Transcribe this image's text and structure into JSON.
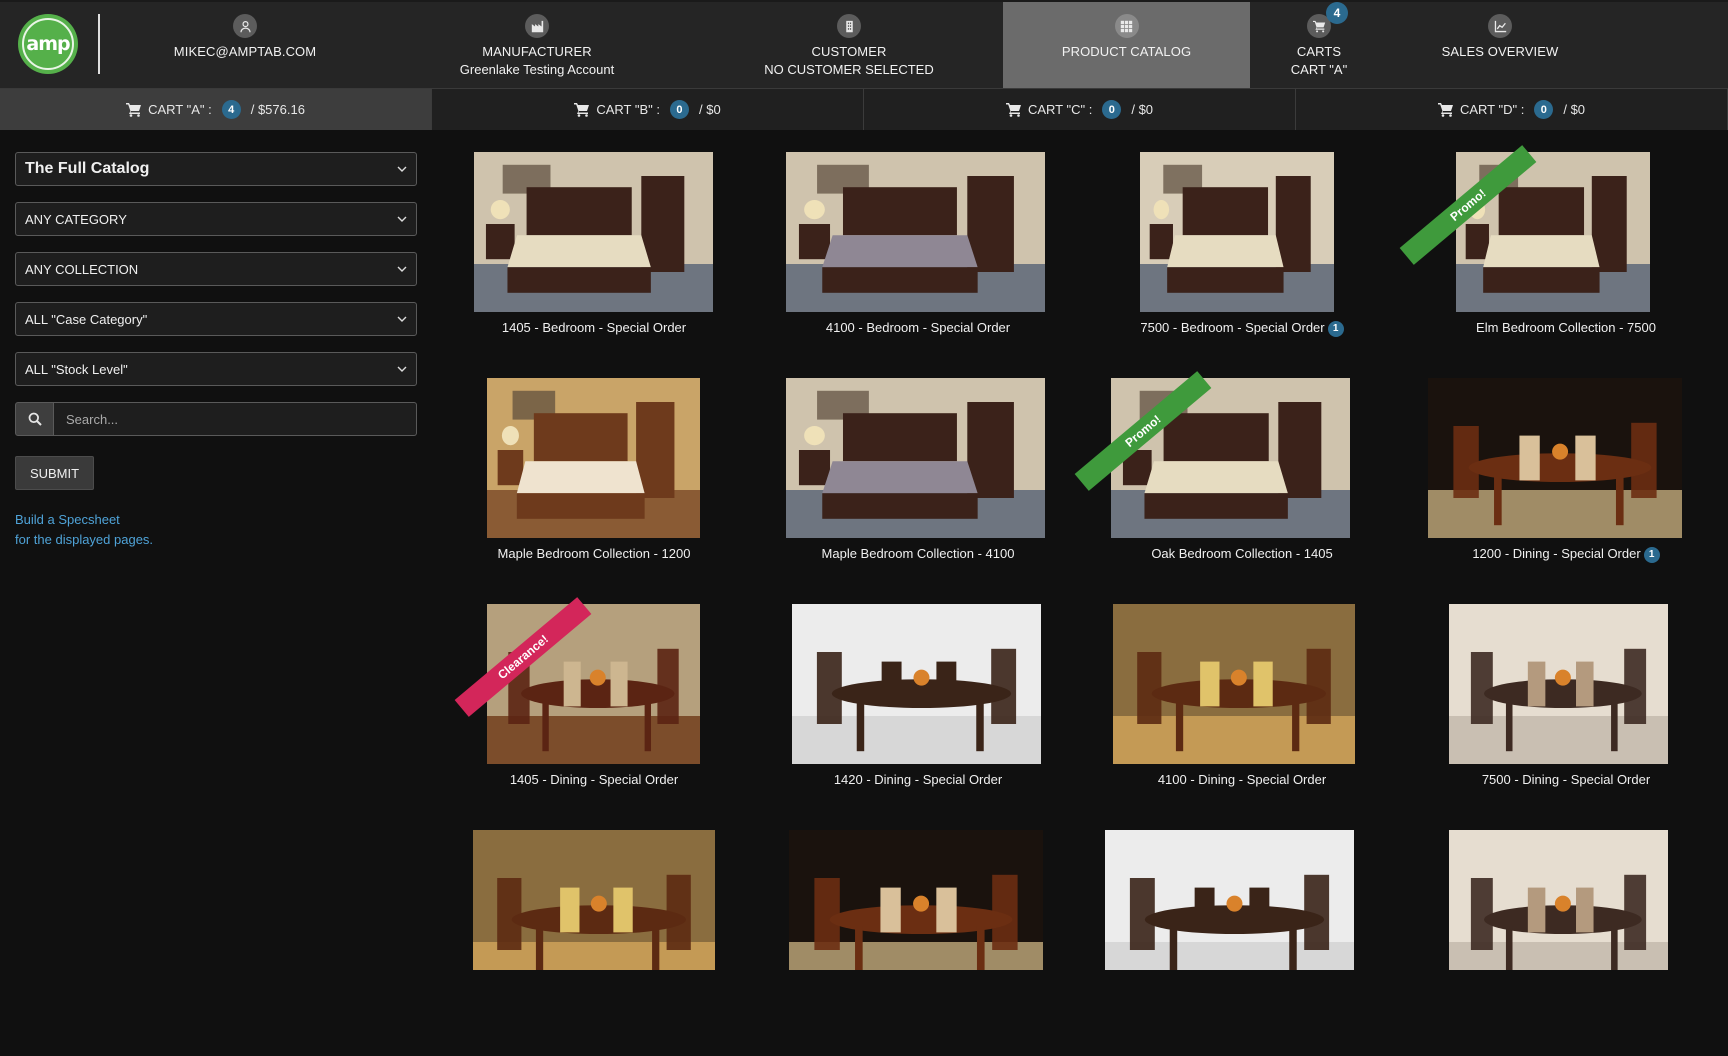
{
  "nav": {
    "user": {
      "line1": "MIKEC@AMPTAB.COM"
    },
    "manufacturer": {
      "line1": "MANUFACTURER",
      "line2": "Greenlake Testing Account"
    },
    "customer": {
      "line1": "CUSTOMER",
      "line2": "NO CUSTOMER SELECTED"
    },
    "catalog": {
      "line1": "PRODUCT CATALOG"
    },
    "carts": {
      "line1": "CARTS",
      "line2": "CART \"A\"",
      "badge": "4"
    },
    "sales": {
      "line1": "SALES OVERVIEW"
    },
    "logo_text": "amp"
  },
  "cartbar": [
    {
      "label": "CART \"A\" :",
      "count": "4",
      "total": "/ $576.16"
    },
    {
      "label": "CART \"B\" :",
      "count": "0",
      "total": "/ $0"
    },
    {
      "label": "CART \"C\" :",
      "count": "0",
      "total": "/ $0"
    },
    {
      "label": "CART \"D\" :",
      "count": "0",
      "total": "/ $0"
    }
  ],
  "sidebar": {
    "catalog_select": "The Full Catalog",
    "category_select": "ANY CATEGORY",
    "collection_select": "ANY COLLECTION",
    "case_category_select": "ALL \"Case Category\"",
    "stock_level_select": "ALL \"Stock Level\"",
    "search_placeholder": "Search...",
    "submit_label": "SUBMIT",
    "spec_line1": "Build a Specsheet",
    "spec_line2": "for the displayed pages."
  },
  "products": [
    {
      "caption": "1405 - Bedroom - Special Order",
      "badge": ""
    },
    {
      "caption": "4100 - Bedroom - Special Order",
      "badge": ""
    },
    {
      "caption": "7500 - Bedroom - Special Order",
      "badge": "1"
    },
    {
      "caption": "Elm Bedroom Collection - 7500",
      "badge": "",
      "ribbon": "Promo!"
    },
    {
      "caption": "Maple Bedroom Collection - 1200",
      "badge": ""
    },
    {
      "caption": "Maple Bedroom Collection - 4100",
      "badge": ""
    },
    {
      "caption": "Oak Bedroom Collection - 1405",
      "badge": "",
      "ribbon": "Promo!"
    },
    {
      "caption": "1200 - Dining - Special Order",
      "badge": "1"
    },
    {
      "caption": "1405 - Dining - Special Order",
      "badge": "",
      "ribbon": "Clearance!"
    },
    {
      "caption": "1420 - Dining - Special Order",
      "badge": ""
    },
    {
      "caption": "4100 - Dining - Special Order",
      "badge": ""
    },
    {
      "caption": "7500 - Dining - Special Order",
      "badge": ""
    },
    {
      "caption": "",
      "badge": ""
    },
    {
      "caption": "",
      "badge": ""
    },
    {
      "caption": "",
      "badge": ""
    },
    {
      "caption": "",
      "badge": ""
    }
  ],
  "colors": {
    "accent_blue": "#2b6a8f",
    "link_blue": "#4fa3d8",
    "promo_green": "#3f9a3c",
    "clearance_pink": "#d3265a",
    "logo_green": "#55b04a"
  }
}
